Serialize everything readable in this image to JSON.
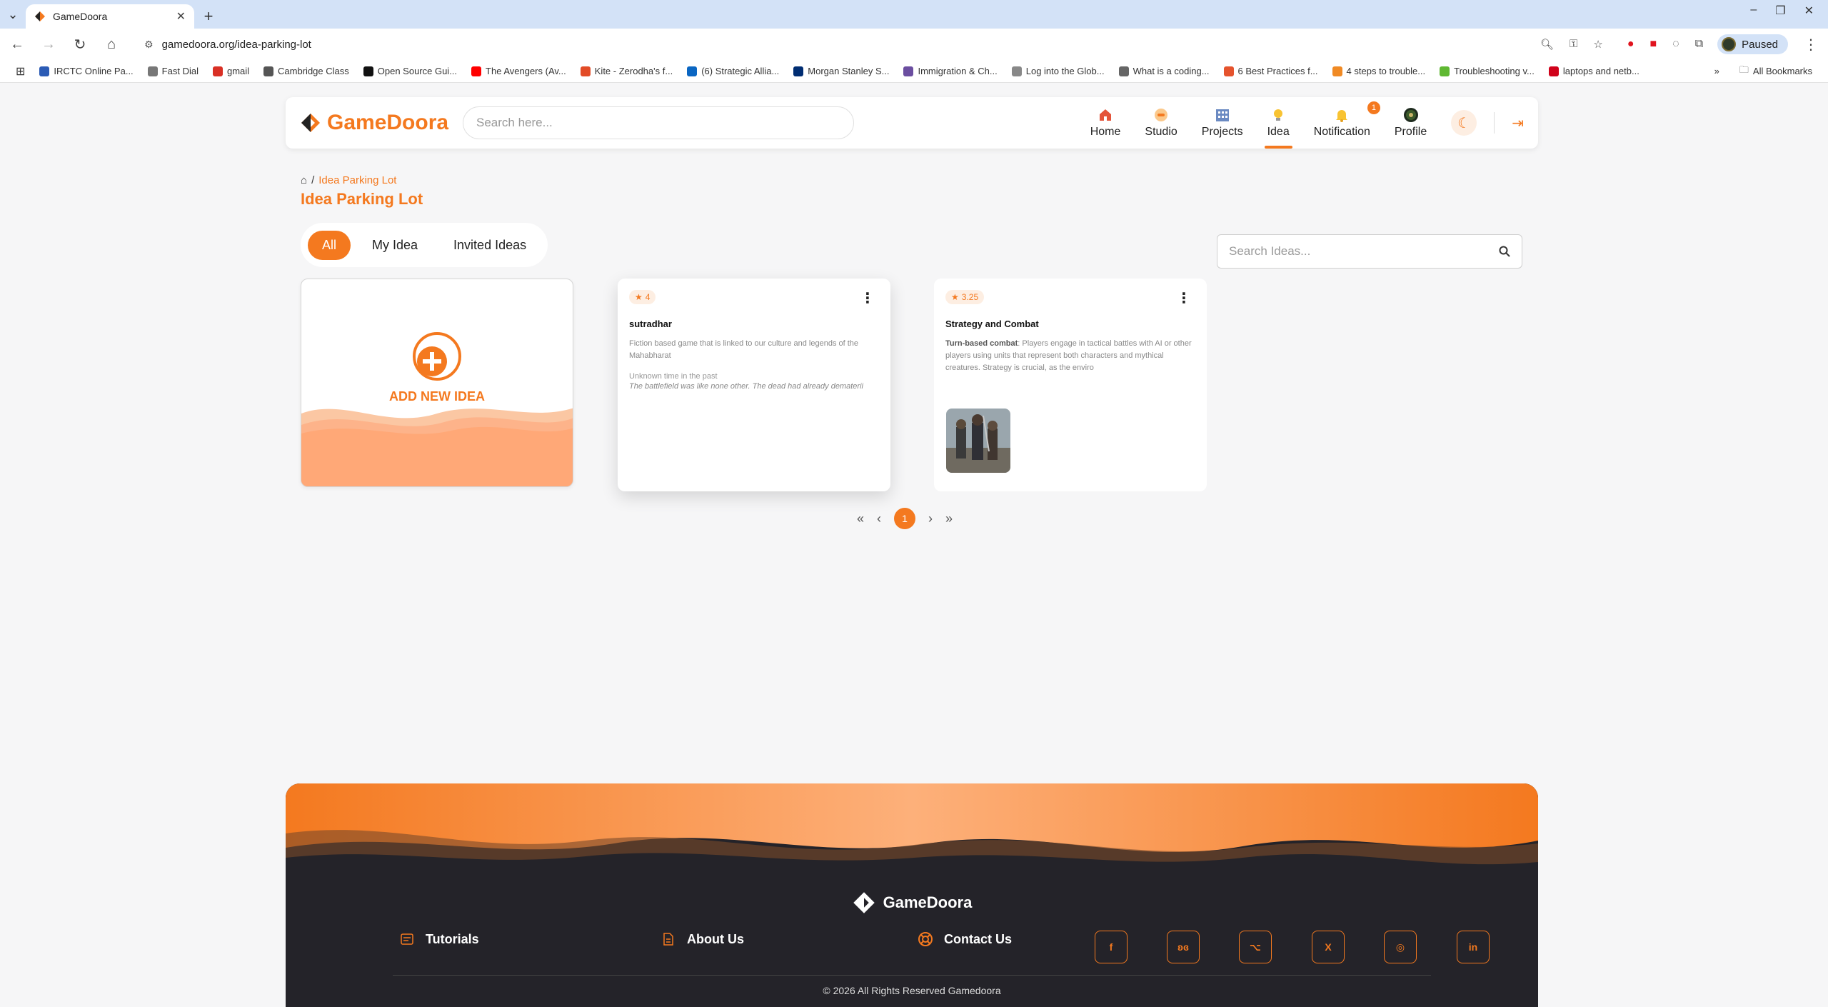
{
  "browser": {
    "tab_title": "GameDoora",
    "url": "gamedoora.org/idea-parking-lot",
    "profile_status": "Paused",
    "bookmarks": [
      {
        "label": "IRCTC Online Pa...",
        "color": "#2b5bb5"
      },
      {
        "label": "Fast Dial",
        "color": "#777777"
      },
      {
        "label": "gmail",
        "color": "#d93025"
      },
      {
        "label": "Cambridge Class",
        "color": "#555555"
      },
      {
        "label": "Open Source Gui...",
        "color": "#111111"
      },
      {
        "label": "The Avengers (Av...",
        "color": "#ff0000"
      },
      {
        "label": "Kite - Zerodha's f...",
        "color": "#e24b26"
      },
      {
        "label": "(6) Strategic Allia...",
        "color": "#0a66c2"
      },
      {
        "label": "Morgan Stanley S...",
        "color": "#002d72"
      },
      {
        "label": "Immigration & Ch...",
        "color": "#6b4ea0"
      },
      {
        "label": "Log into the Glob...",
        "color": "#888888"
      },
      {
        "label": "What is a coding...",
        "color": "#666666"
      },
      {
        "label": "6 Best Practices f...",
        "color": "#e5532d"
      },
      {
        "label": "4 steps to trouble...",
        "color": "#f08a24"
      },
      {
        "label": "Troubleshooting v...",
        "color": "#5fb832"
      },
      {
        "label": "laptops and netb...",
        "color": "#d0021b"
      }
    ],
    "all_bookmarks": "All Bookmarks"
  },
  "header": {
    "logo_text": "GameDoora",
    "search_placeholder": "Search here...",
    "nav": [
      {
        "label": "Home"
      },
      {
        "label": "Studio"
      },
      {
        "label": "Projects"
      },
      {
        "label": "Idea"
      },
      {
        "label": "Notification",
        "badge": "1"
      },
      {
        "label": "Profile"
      }
    ]
  },
  "breadcrumb": {
    "current": "Idea Parking Lot"
  },
  "page_title": "Idea Parking Lot",
  "tabs": [
    "All",
    "My Idea",
    "Invited Ideas"
  ],
  "active_tab": "All",
  "idea_search_placeholder": "Search Ideas...",
  "add_card_label": "ADD NEW IDEA",
  "ideas": [
    {
      "rating": "4",
      "title": "sutradhar",
      "description": "Fiction based game that is linked to our culture and legends of the Mahabharat",
      "meta": "Unknown time in the past",
      "quote": "The battlefield was like none other. The dead had already dematerii"
    },
    {
      "rating": "3.25",
      "title": "Strategy and Combat",
      "description_bold": "Turn-based combat",
      "description": ": Players engage in tactical battles with AI or other players using units that represent both characters and mythical creatures. Strategy is crucial, as the enviro"
    }
  ],
  "pagination": {
    "current": "1"
  },
  "footer": {
    "logo_text": "GameDoora",
    "links": [
      "Tutorials",
      "About Us",
      "Contact Us"
    ],
    "copyright": "© 2026 All Rights Reserved Gamedoora"
  },
  "colors": {
    "accent": "#f4791f",
    "footer_bg": "#242329",
    "page_bg": "#f6f6f7"
  }
}
